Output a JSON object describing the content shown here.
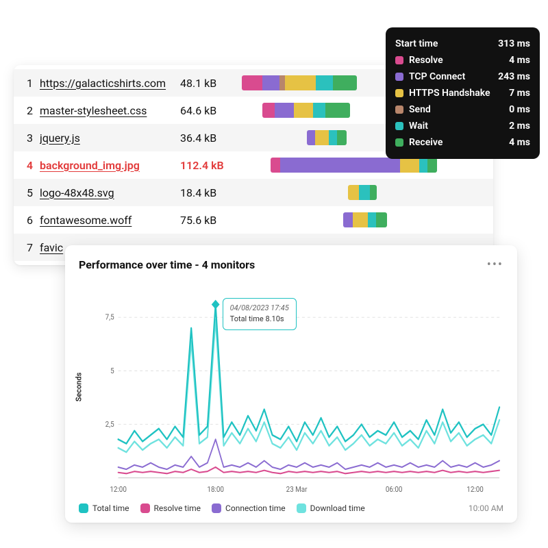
{
  "colors": {
    "resolve": "#d94b8f",
    "tcp": "#8a6bd1",
    "https": "#e6c244",
    "send": "#b8866b",
    "wait": "#2bc1bd",
    "receive": "#3fae5e",
    "total_time": "#1fc2c2",
    "resolve_time": "#d94b8f",
    "connection_time": "#8a6bd1",
    "download_time": "#6fe2df"
  },
  "waterfall": {
    "rows": [
      {
        "idx": "1",
        "name": "https://galacticshirts.com",
        "size": "48.1 kB",
        "highlight": false,
        "bar": {
          "left": 0,
          "segs": [
            {
              "c": "resolve",
              "w": 30
            },
            {
              "c": "tcp",
              "w": 25
            },
            {
              "c": "send",
              "w": 8
            },
            {
              "c": "https",
              "w": 45
            },
            {
              "c": "wait",
              "w": 25
            },
            {
              "c": "receive",
              "w": 35
            }
          ]
        }
      },
      {
        "idx": "2",
        "name": "master-stylesheet.css",
        "size": "64.6 kB",
        "highlight": false,
        "bar": {
          "left": 30,
          "segs": [
            {
              "c": "resolve",
              "w": 18
            },
            {
              "c": "tcp",
              "w": 28
            },
            {
              "c": "https",
              "w": 28
            },
            {
              "c": "wait",
              "w": 18
            },
            {
              "c": "receive",
              "w": 36
            }
          ]
        }
      },
      {
        "idx": "3",
        "name": "jquery.js",
        "size": "36.4 kB",
        "highlight": false,
        "bar": {
          "left": 95,
          "segs": [
            {
              "c": "tcp",
              "w": 12
            },
            {
              "c": "https",
              "w": 20
            },
            {
              "c": "wait",
              "w": 12
            },
            {
              "c": "receive",
              "w": 14
            }
          ]
        }
      },
      {
        "idx": "4",
        "name": "background_img.jpg",
        "size": "112.4 kB",
        "highlight": true,
        "bar": {
          "left": 42,
          "segs": [
            {
              "c": "resolve",
              "w": 14
            },
            {
              "c": "tcp",
              "w": 175
            },
            {
              "c": "https",
              "w": 28
            },
            {
              "c": "wait",
              "w": 12
            },
            {
              "c": "receive",
              "w": 14
            }
          ]
        }
      },
      {
        "idx": "5",
        "name": "logo-48x48.svg",
        "size": "18.4 kB",
        "highlight": false,
        "bar": {
          "left": 155,
          "segs": [
            {
              "c": "https",
              "w": 16
            },
            {
              "c": "wait",
              "w": 16
            },
            {
              "c": "receive",
              "w": 10
            }
          ]
        }
      },
      {
        "idx": "6",
        "name": "fontawesome.woff",
        "size": "75.6 kB",
        "highlight": false,
        "bar": {
          "left": 148,
          "segs": [
            {
              "c": "tcp",
              "w": 14
            },
            {
              "c": "https",
              "w": 22
            },
            {
              "c": "wait",
              "w": 12
            },
            {
              "c": "receive",
              "w": 16
            }
          ]
        }
      },
      {
        "idx": "7",
        "name": "favic",
        "size": "",
        "highlight": false,
        "bar": null
      }
    ]
  },
  "tooltip": {
    "rows": [
      {
        "swatch": null,
        "label": "Start time",
        "value": "313 ms"
      },
      {
        "swatch": "resolve",
        "label": "Resolve",
        "value": "4 ms"
      },
      {
        "swatch": "tcp",
        "label": "TCP Connect",
        "value": "243 ms"
      },
      {
        "swatch": "https",
        "label": "HTTPS Handshake",
        "value": "7 ms"
      },
      {
        "swatch": "send",
        "label": "Send",
        "value": "0 ms"
      },
      {
        "swatch": "wait",
        "label": "Wait",
        "value": "2 ms"
      },
      {
        "swatch": "receive",
        "label": "Receive",
        "value": "4 ms"
      }
    ]
  },
  "chart": {
    "title": "Performance over time - 4 monitors",
    "yaxis": "Seconds",
    "hover": {
      "timestamp": "04/08/2023 17:45",
      "text": "Total time 8.10s"
    },
    "legend": [
      {
        "key": "total_time",
        "label": "Total time"
      },
      {
        "key": "resolve_time",
        "label": "Resolve time"
      },
      {
        "key": "connection_time",
        "label": "Connection time"
      },
      {
        "key": "download_time",
        "label": "Download time"
      }
    ],
    "timestamp": "10:00 AM",
    "xticks": [
      "12:00",
      "18:00",
      "23 Mar",
      "06:00",
      "12:00"
    ],
    "yticks": [
      "2,5",
      "5",
      "7,5"
    ]
  },
  "chart_data": {
    "type": "line",
    "xlabel": "",
    "ylabel": "Seconds",
    "ylim": [
      0,
      9
    ],
    "x": [
      0,
      1,
      2,
      3,
      4,
      5,
      6,
      7,
      8,
      9,
      10,
      11,
      12,
      13,
      14,
      15,
      16,
      17,
      18,
      19,
      20,
      21,
      22,
      23,
      24,
      25,
      26,
      27,
      28,
      29,
      30,
      31,
      32,
      33,
      34,
      35,
      36,
      37,
      38,
      39,
      40,
      41,
      42,
      43,
      44,
      45,
      46,
      47
    ],
    "series": [
      {
        "name": "Total time",
        "color_key": "total_time",
        "values": [
          1.8,
          1.6,
          2.2,
          1.7,
          2.0,
          2.3,
          1.8,
          2.4,
          1.9,
          7.0,
          2.0,
          2.4,
          8.1,
          1.9,
          2.6,
          2.0,
          2.9,
          2.2,
          3.2,
          2.0,
          1.8,
          2.4,
          1.7,
          2.6,
          2.0,
          2.8,
          1.9,
          2.4,
          1.7,
          2.0,
          2.5,
          1.9,
          2.2,
          2.0,
          2.6,
          1.9,
          2.2,
          1.8,
          2.7,
          2.0,
          3.2,
          2.1,
          2.6,
          1.9,
          2.3,
          2.5,
          2.0,
          3.3
        ]
      },
      {
        "name": "Download time",
        "color_key": "download_time",
        "values": [
          1.4,
          1.2,
          1.7,
          1.3,
          1.6,
          1.8,
          1.4,
          1.9,
          1.5,
          6.4,
          1.6,
          1.9,
          7.4,
          1.5,
          2.1,
          1.6,
          2.3,
          1.7,
          2.6,
          1.6,
          1.4,
          1.9,
          1.3,
          2.1,
          1.6,
          2.2,
          1.5,
          1.9,
          1.3,
          1.6,
          2.0,
          1.5,
          1.8,
          1.6,
          2.1,
          1.5,
          1.8,
          1.4,
          2.2,
          1.6,
          2.6,
          1.7,
          2.1,
          1.5,
          1.8,
          2.0,
          1.6,
          2.7
        ]
      },
      {
        "name": "Connection time",
        "color_key": "connection_time",
        "values": [
          0.5,
          0.4,
          0.6,
          0.5,
          0.7,
          0.5,
          0.4,
          0.6,
          0.5,
          1.0,
          0.5,
          0.7,
          1.8,
          0.5,
          0.6,
          0.5,
          0.7,
          0.5,
          0.8,
          0.5,
          0.4,
          0.6,
          0.5,
          0.7,
          0.5,
          0.6,
          0.5,
          0.7,
          0.4,
          0.5,
          0.6,
          0.5,
          0.7,
          0.5,
          0.6,
          0.5,
          0.7,
          0.5,
          0.6,
          0.5,
          0.8,
          0.5,
          0.6,
          0.5,
          0.7,
          0.5,
          0.6,
          0.8
        ]
      },
      {
        "name": "Resolve time",
        "color_key": "resolve_time",
        "values": [
          0.25,
          0.2,
          0.3,
          0.25,
          0.3,
          0.25,
          0.2,
          0.3,
          0.25,
          0.4,
          0.25,
          0.3,
          0.5,
          0.25,
          0.3,
          0.25,
          0.3,
          0.25,
          0.35,
          0.25,
          0.2,
          0.3,
          0.25,
          0.3,
          0.25,
          0.3,
          0.25,
          0.3,
          0.2,
          0.25,
          0.3,
          0.25,
          0.3,
          0.25,
          0.3,
          0.25,
          0.3,
          0.25,
          0.3,
          0.25,
          0.35,
          0.25,
          0.3,
          0.25,
          0.3,
          0.25,
          0.3,
          0.35
        ]
      }
    ],
    "hover_point": {
      "x": 12,
      "series": "Total time",
      "value": 8.1,
      "timestamp": "04/08/2023 17:45"
    }
  }
}
